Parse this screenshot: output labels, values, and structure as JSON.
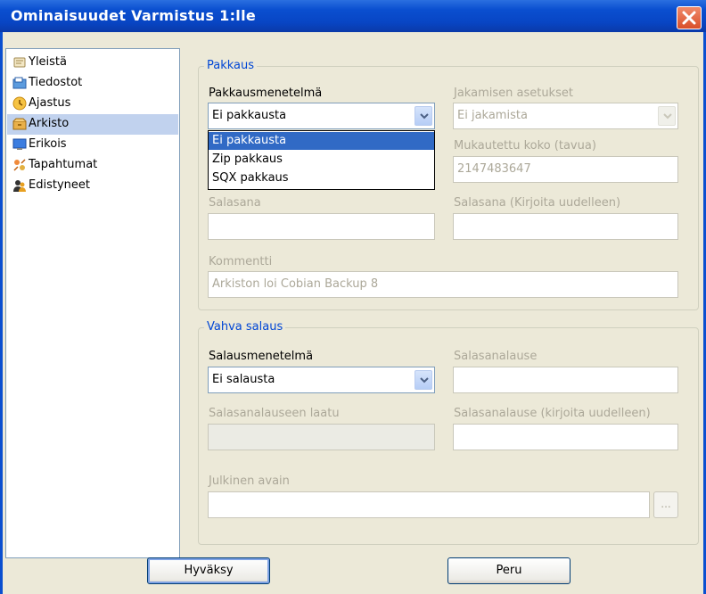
{
  "window": {
    "title": "Ominaisuudet Varmistus 1:lle"
  },
  "sidebar": {
    "items": [
      {
        "label": "Yleistä",
        "icon": "document-icon"
      },
      {
        "label": "Tiedostot",
        "icon": "files-icon"
      },
      {
        "label": "Ajastus",
        "icon": "clock-icon"
      },
      {
        "label": "Arkisto",
        "icon": "archive-box-icon",
        "selected": true
      },
      {
        "label": "Erikois",
        "icon": "monitor-icon"
      },
      {
        "label": "Tapahtumat",
        "icon": "events-icon"
      },
      {
        "label": "Edistyneet",
        "icon": "advanced-users-icon"
      }
    ]
  },
  "pakkaus": {
    "legend": "Pakkaus",
    "method_label": "Pakkausmenetelmä",
    "method_value": "Ei pakkausta",
    "method_options": [
      "Ei pakkausta",
      "Zip pakkaus",
      "SQX pakkaus"
    ],
    "split_label": "Jakamisen asetukset",
    "split_value": "Ei jakamista",
    "custom_size_label": "Mukautettu koko (tavua)",
    "custom_size_value": "2147483647",
    "password_label": "Salasana",
    "password_repeat_label": "Salasana (Kirjoita uudelleen)",
    "comment_label": "Kommentti",
    "comment_value": "Arkiston loi Cobian Backup 8"
  },
  "encryption": {
    "legend": "Vahva salaus",
    "method_label": "Salausmenetelmä",
    "method_value": "Ei salausta",
    "passphrase_label": "Salasanalause",
    "quality_label": "Salasanalauseen laatu",
    "passphrase_repeat_label": "Salasanalause (kirjoita uudelleen)",
    "public_key_label": "Julkinen avain",
    "browse_label": "..."
  },
  "buttons": {
    "ok": "Hyväksy",
    "cancel": "Peru"
  },
  "colors": {
    "titlebar": "#0a4fd0",
    "legend": "#0046d5",
    "selection": "#316ac5",
    "sidebar_selected": "#c1d2ee"
  }
}
